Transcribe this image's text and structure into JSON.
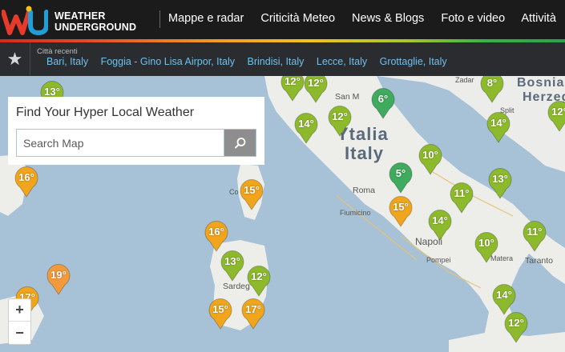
{
  "logo": {
    "line1": "WEATHER",
    "line2": "UNDERGROUND"
  },
  "nav": {
    "items": [
      "Mappe e radar",
      "Criticità Meteo",
      "News & Blogs",
      "Foto e video",
      "Attività"
    ]
  },
  "recent": {
    "label": "Città recenti",
    "cities": [
      "Bari, Italy",
      "Foggia - Gino Lisa Airpor, Italy",
      "Brindisi, Italy",
      "Lecce, Italy",
      "Grottaglie, Italy"
    ]
  },
  "search": {
    "title": "Find Your Hyper Local Weather",
    "placeholder": "Search Map"
  },
  "zoom": {
    "in": "+",
    "out": "−"
  },
  "map_labels": {
    "italia": "Ytalia",
    "italy": "Italy",
    "bosnia": "Bosnia",
    "herzeg": "Herzeg",
    "san_m": "San M",
    "roma": "Roma",
    "fiumicino": "Fiumicino",
    "napoli": "Napoli",
    "pompei": "Pompei",
    "matera": "Matera",
    "taranto": "Taranto",
    "sardegna": "Sardeg",
    "split": "Split",
    "zadar": "Zadar",
    "co": "Co"
  },
  "pins": [
    {
      "temp": "13°",
      "color": "#8dba2c"
    },
    {
      "temp": "12°",
      "color": "#8dba2c"
    },
    {
      "temp": "12°",
      "color": "#8dba2c"
    },
    {
      "temp": "6°",
      "color": "#3fab5e"
    },
    {
      "temp": "8°",
      "color": "#8dba2c"
    },
    {
      "temp": "14°",
      "color": "#8dba2c"
    },
    {
      "temp": "12°",
      "color": "#8dba2c"
    },
    {
      "temp": "14°",
      "color": "#8dba2c"
    },
    {
      "temp": "12°",
      "color": "#8dba2c"
    },
    {
      "temp": "10°",
      "color": "#8dba2c"
    },
    {
      "temp": "16°",
      "color": "#f0a51c"
    },
    {
      "temp": "5°",
      "color": "#3fab5e"
    },
    {
      "temp": "13°",
      "color": "#8dba2c"
    },
    {
      "temp": "15°",
      "color": "#f0a51c"
    },
    {
      "temp": "11°",
      "color": "#8dba2c"
    },
    {
      "temp": "15°",
      "color": "#f0a51c"
    },
    {
      "temp": "14°",
      "color": "#8dba2c"
    },
    {
      "temp": "16°",
      "color": "#f0a51c"
    },
    {
      "temp": "11°",
      "color": "#8dba2c"
    },
    {
      "temp": "13°",
      "color": "#8dba2c"
    },
    {
      "temp": "10°",
      "color": "#8dba2c"
    },
    {
      "temp": "12°",
      "color": "#8dba2c"
    },
    {
      "temp": "19°",
      "color": "#f39b3c"
    },
    {
      "temp": "17°",
      "color": "#f0a51c"
    },
    {
      "temp": "14°",
      "color": "#8dba2c"
    },
    {
      "temp": "15°",
      "color": "#f0a51c"
    },
    {
      "temp": "17°",
      "color": "#f0a51c"
    },
    {
      "temp": "12°",
      "color": "#8dba2c"
    }
  ]
}
